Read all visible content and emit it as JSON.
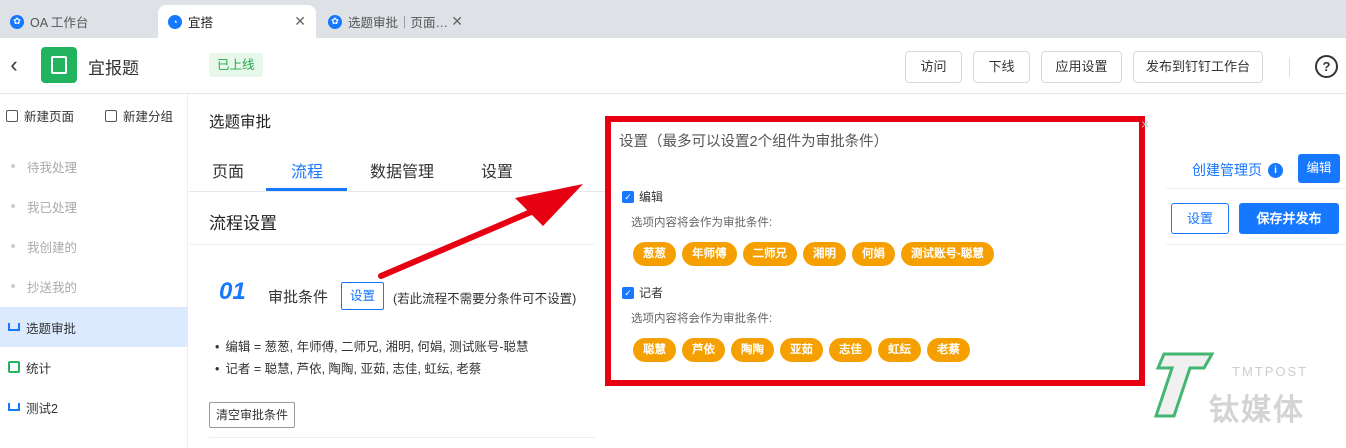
{
  "browser": {
    "tabs": [
      {
        "label": "OA 工作台",
        "icon": "app-icon"
      },
      {
        "label": "宜搭",
        "icon": "yida-icon",
        "close": "✕"
      },
      {
        "label": "选题审批｜页面…",
        "icon": "app-icon",
        "close": "✕"
      }
    ]
  },
  "header": {
    "app_name": "宜报题",
    "status": "已上线",
    "buttons": [
      "访问",
      "下线",
      "应用设置",
      "发布到钉钉工作台"
    ],
    "help": "?"
  },
  "sidebar": {
    "new_page": "新建页面",
    "new_group": "新建分组",
    "items": [
      {
        "label": "待我处理",
        "state": "muted"
      },
      {
        "label": "我已处理",
        "state": "muted"
      },
      {
        "label": "我创建的",
        "state": "muted"
      },
      {
        "label": "抄送我的",
        "state": "muted"
      },
      {
        "label": "选题审批",
        "state": "active"
      },
      {
        "label": "统计",
        "state": "normal"
      },
      {
        "label": "测试2",
        "state": "normal"
      }
    ]
  },
  "main": {
    "page_title": "选题审批",
    "tabs": [
      "页面",
      "流程",
      "数据管理",
      "设置"
    ],
    "active_tab": "流程",
    "section_title": "流程设置",
    "step_number": "01",
    "condition_label": "审批条件",
    "condition_set_button": "设置",
    "condition_note": "(若此流程不需要分条件可不设置)",
    "conditions": [
      "编辑 = 葱葱, 年师傅, 二师兄, 湘明, 何娟, 测试账号-聪慧",
      "记者 = 聪慧, 芦依, 陶陶, 亚茹, 志佳, 虹纭, 老蔡"
    ],
    "clear_button": "清空审批条件"
  },
  "popup": {
    "title": "设置（最多可以设置2个组件为审批条件）",
    "close": "×",
    "groups": [
      {
        "label": "编辑",
        "hint": "选项内容将会作为审批条件:",
        "tags": [
          "葱葱",
          "年师傅",
          "二师兄",
          "湘明",
          "何娟",
          "测试账号-聪慧"
        ]
      },
      {
        "label": "记者",
        "hint": "选项内容将会作为审批条件:",
        "tags": [
          "聪慧",
          "芦依",
          "陶陶",
          "亚茹",
          "志佳",
          "虹纭",
          "老蔡"
        ]
      }
    ]
  },
  "right_panel": {
    "create_manage_page": "创建管理页",
    "edit_button": "编辑",
    "settings_button": "设置",
    "save_publish_button": "保存并发布"
  },
  "watermark": {
    "text_en": "TMTPOST",
    "text_cn": "钛媒体"
  },
  "colors": {
    "primary": "#1677ff",
    "tag": "#f5a000",
    "highlight_border": "#e60012",
    "status_green": "#22a94a"
  }
}
